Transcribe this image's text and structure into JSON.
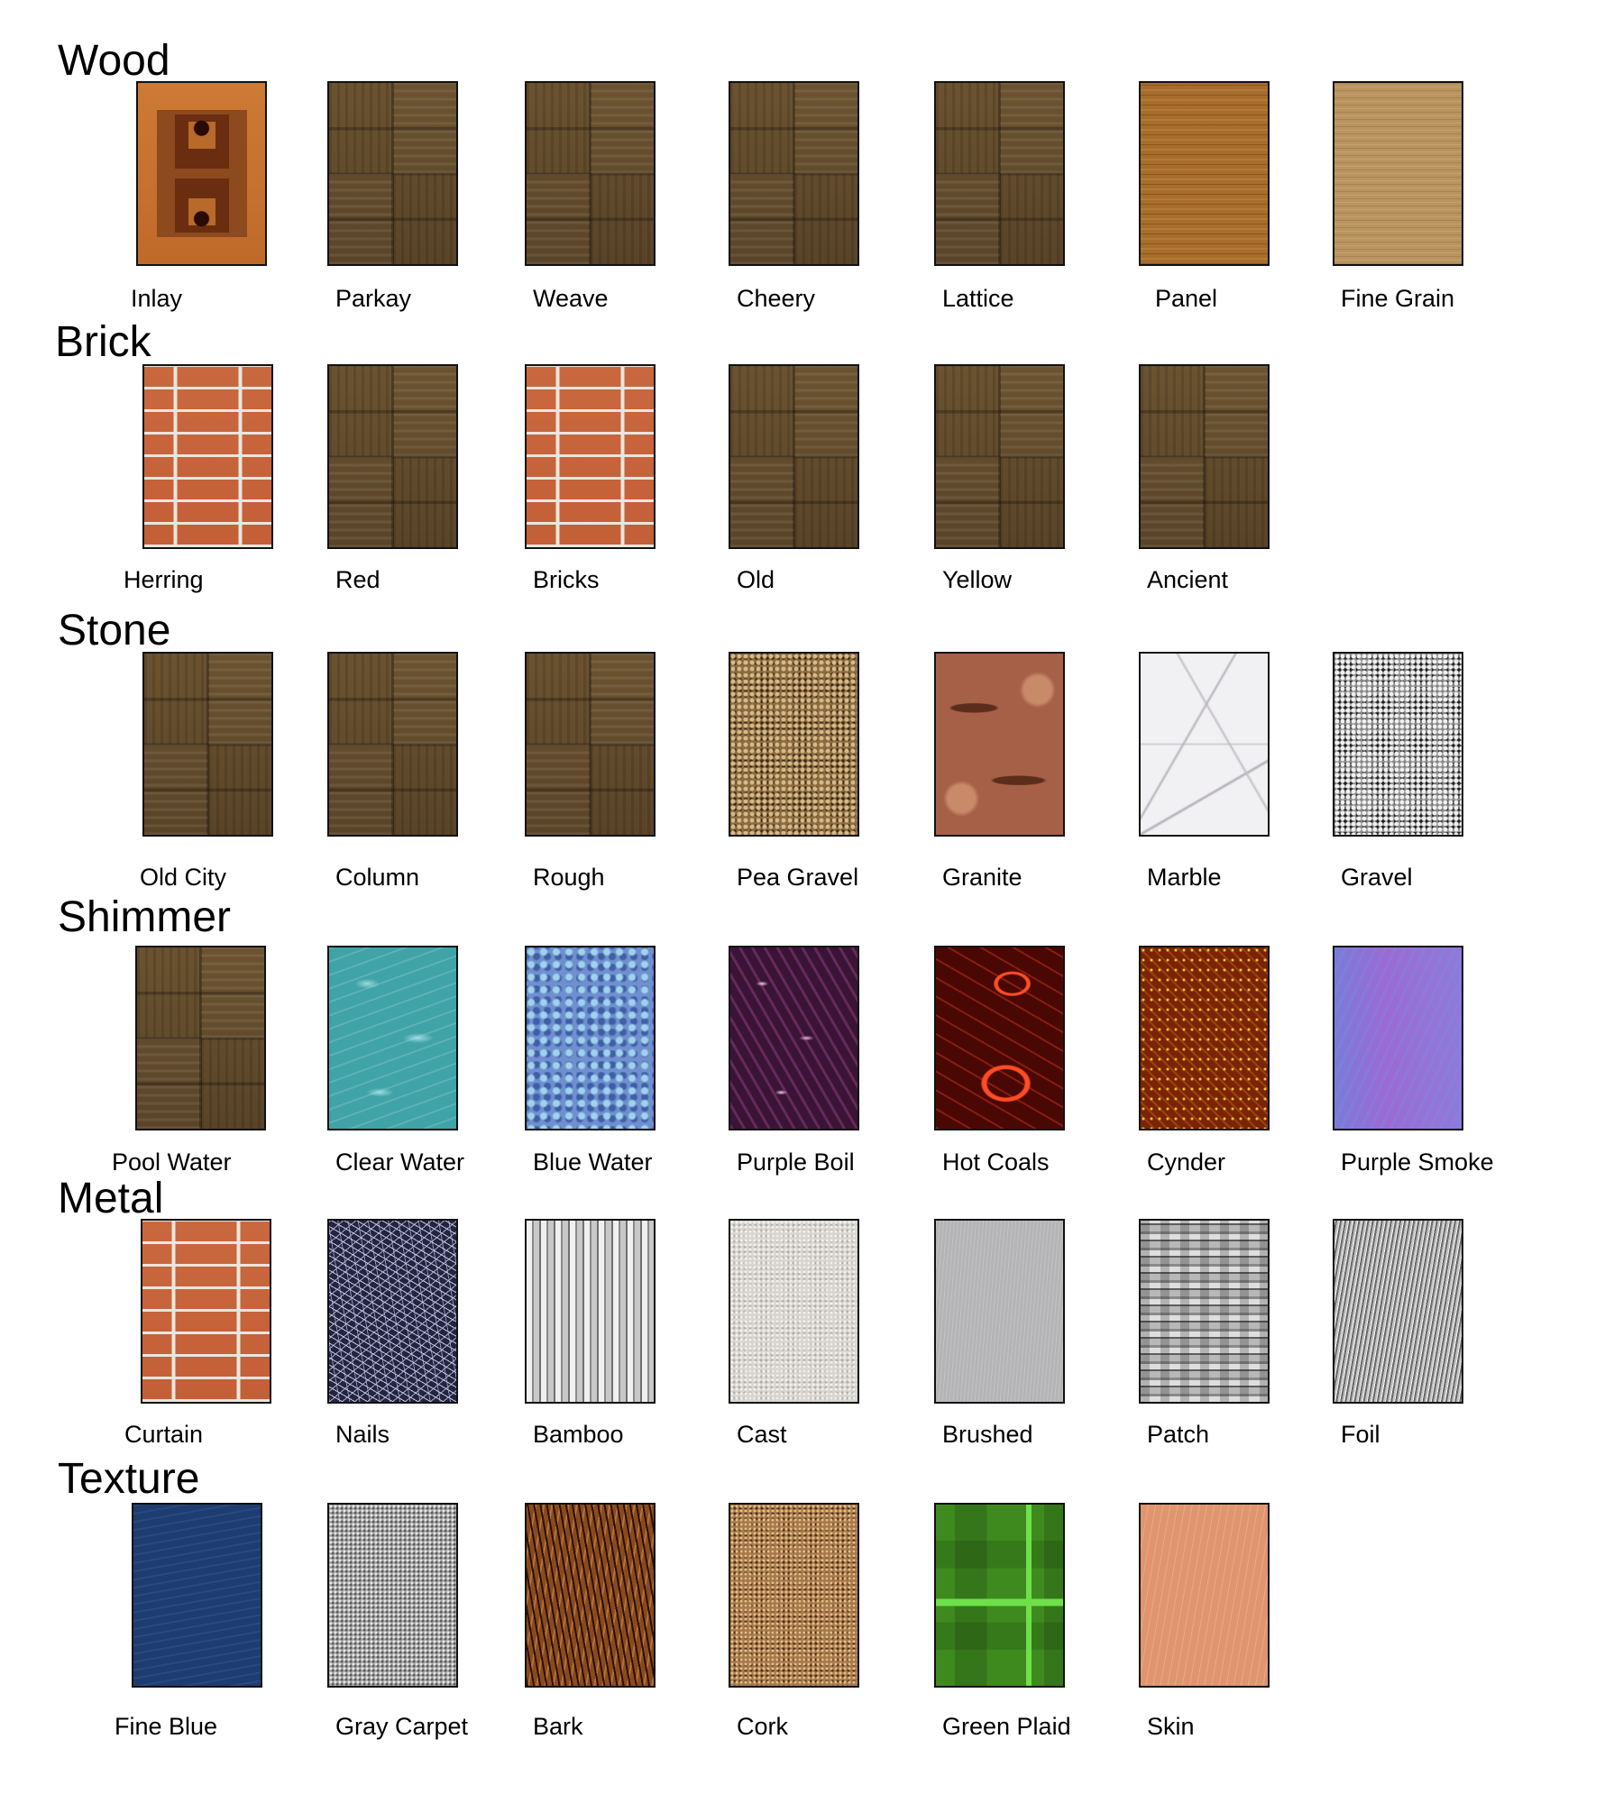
{
  "categories": [
    {
      "title": "Wood",
      "items": [
        {
          "label": "Inlay",
          "texture": "inlay"
        },
        {
          "label": "Parkay",
          "texture": "parquet"
        },
        {
          "label": "Weave",
          "texture": "parquet"
        },
        {
          "label": "Cheery",
          "texture": "parquet"
        },
        {
          "label": "Lattice",
          "texture": "parquet"
        },
        {
          "label": "Panel",
          "texture": "panel"
        },
        {
          "label": "Fine Grain",
          "texture": "finegrain"
        }
      ]
    },
    {
      "title": "Brick",
      "items": [
        {
          "label": "Herring",
          "texture": "brick"
        },
        {
          "label": "Red",
          "texture": "parquet"
        },
        {
          "label": "Bricks",
          "texture": "brick"
        },
        {
          "label": "Old",
          "texture": "parquet"
        },
        {
          "label": "Yellow",
          "texture": "parquet"
        },
        {
          "label": "Ancient",
          "texture": "parquet"
        }
      ]
    },
    {
      "title": "Stone",
      "items": [
        {
          "label": "Old City",
          "texture": "parquet"
        },
        {
          "label": "Column",
          "texture": "parquet"
        },
        {
          "label": "Rough",
          "texture": "parquet"
        },
        {
          "label": "Pea Gravel",
          "texture": "peagravel"
        },
        {
          "label": "Granite",
          "texture": "granite"
        },
        {
          "label": "Marble",
          "texture": "marble"
        },
        {
          "label": "Gravel",
          "texture": "gravel"
        }
      ]
    },
    {
      "title": "Shimmer",
      "items": [
        {
          "label": "Pool Water",
          "texture": "parquet"
        },
        {
          "label": "Clear Water",
          "texture": "poolwater"
        },
        {
          "label": "Blue Water",
          "texture": "bluewater"
        },
        {
          "label": "Purple Boil",
          "texture": "purpleboil"
        },
        {
          "label": "Hot Coals",
          "texture": "hotcoals"
        },
        {
          "label": "Cynder",
          "texture": "cynder"
        },
        {
          "label": "Purple Smoke",
          "texture": "purplesmoke"
        }
      ]
    },
    {
      "title": "Metal",
      "items": [
        {
          "label": "Curtain",
          "texture": "brick"
        },
        {
          "label": "Nails",
          "texture": "nails"
        },
        {
          "label": "Bamboo",
          "texture": "bamboo"
        },
        {
          "label": "Cast",
          "texture": "cast"
        },
        {
          "label": "Brushed",
          "texture": "brushed"
        },
        {
          "label": "Patch",
          "texture": "patch"
        },
        {
          "label": "Foil",
          "texture": "foil"
        }
      ]
    },
    {
      "title": "Texture",
      "items": [
        {
          "label": "Fine Blue",
          "texture": "fineblue"
        },
        {
          "label": "Gray Carpet",
          "texture": "graycarpet"
        },
        {
          "label": "Bark",
          "texture": "bark"
        },
        {
          "label": "Cork",
          "texture": "cork"
        },
        {
          "label": "Green Plaid",
          "texture": "greenplaid"
        },
        {
          "label": "Skin",
          "texture": "skin"
        }
      ]
    }
  ]
}
